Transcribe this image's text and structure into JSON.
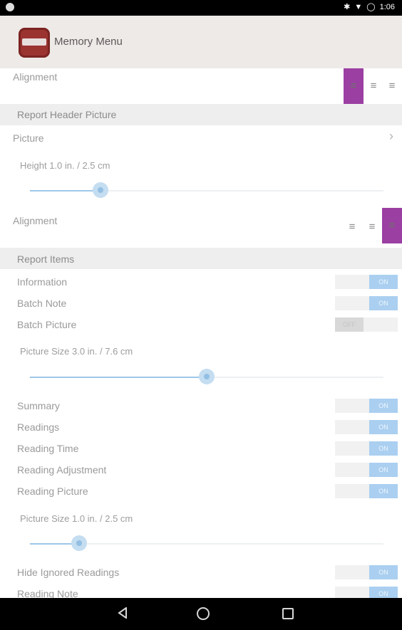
{
  "status_bar": {
    "time": "1:06",
    "icons": [
      "bluetooth-icon",
      "wifi-icon",
      "alarm-icon"
    ]
  },
  "app_bar": {
    "title": "Memory Menu"
  },
  "sections": {
    "alignment_top": {
      "label": "Alignment",
      "selected": "left"
    },
    "header_picture": {
      "title": "Report Header Picture",
      "picture_label": "Picture",
      "height_label": "Height 1.0 in. / 2.5 cm",
      "height_value_fraction": 0.2,
      "alignment_label": "Alignment",
      "alignment_selected": "right"
    },
    "report_items": {
      "title": "Report Items",
      "toggles": [
        {
          "label": "Information",
          "state": "ON"
        },
        {
          "label": "Batch Note",
          "state": "ON"
        },
        {
          "label": "Batch Picture",
          "state": "OFF"
        }
      ],
      "picture_size_label": "Picture Size 3.0 in. / 7.6 cm",
      "picture_size_fraction": 0.5,
      "toggles2": [
        {
          "label": "Summary",
          "state": "ON"
        },
        {
          "label": "Readings",
          "state": "ON"
        },
        {
          "label": "Reading Time",
          "state": "ON"
        },
        {
          "label": "Reading Adjustment",
          "state": "ON"
        },
        {
          "label": "Reading Picture",
          "state": "ON"
        }
      ],
      "reading_picture_size_label": "Picture Size 1.0 in. / 2.5 cm",
      "reading_picture_size_fraction": 0.14,
      "toggles3": [
        {
          "label": "Hide Ignored Readings",
          "state": "ON"
        },
        {
          "label": "Reading Note",
          "state": "ON"
        }
      ]
    }
  },
  "nav_bar": {
    "icons": [
      "back-icon",
      "home-icon",
      "recents-icon"
    ]
  }
}
